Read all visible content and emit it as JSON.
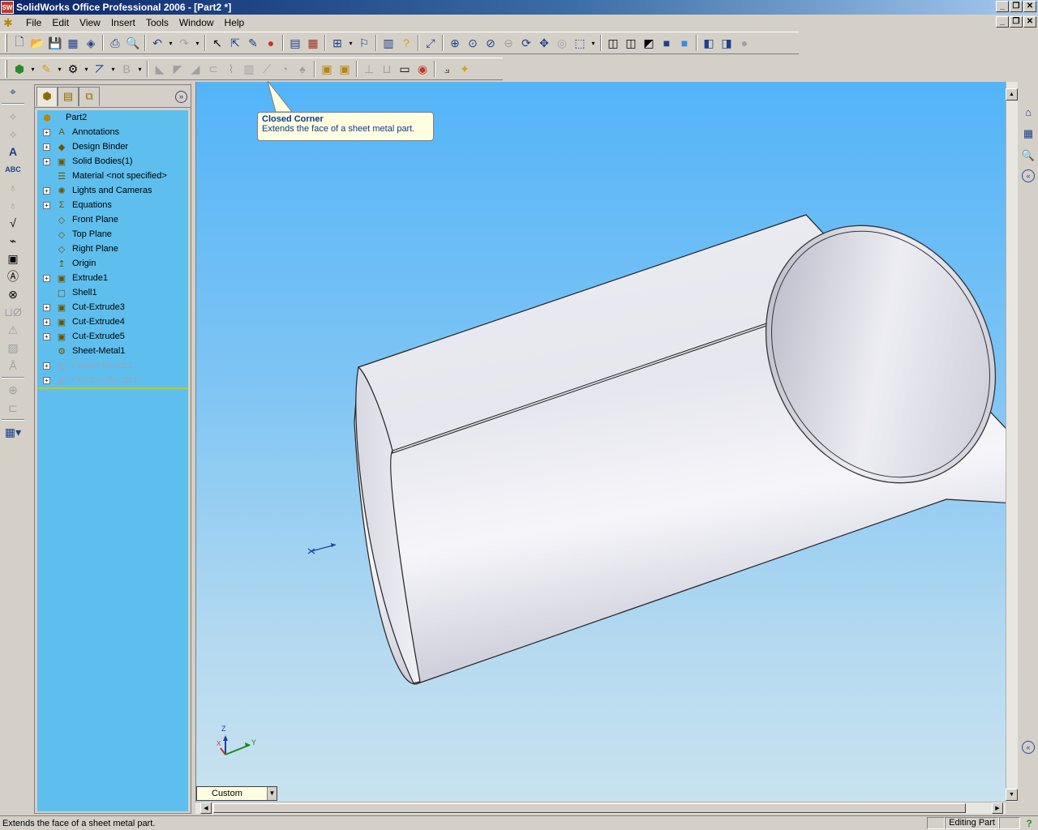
{
  "window": {
    "title": "SolidWorks Office Professional 2006 - [Part2 *]",
    "logo_text": "SW",
    "minimize": "_",
    "restore": "❐",
    "close": "✕"
  },
  "menu": {
    "items": [
      "File",
      "Edit",
      "View",
      "Insert",
      "Tools",
      "Window",
      "Help"
    ]
  },
  "feature_tree": {
    "root": "Part2",
    "items": [
      {
        "label": "Annotations",
        "icon": "annotations-icon",
        "glyph": "A",
        "expandable": true,
        "dim": false
      },
      {
        "label": "Design Binder",
        "icon": "design-binder-icon",
        "glyph": "◆",
        "expandable": true,
        "dim": false
      },
      {
        "label": "Solid Bodies(1)",
        "icon": "solid-bodies-icon",
        "glyph": "▣",
        "expandable": true,
        "dim": false
      },
      {
        "label": "Material <not specified>",
        "icon": "material-icon",
        "glyph": "☰",
        "expandable": false,
        "dim": false
      },
      {
        "label": "Lights and Cameras",
        "icon": "lights-cameras-icon",
        "glyph": "✺",
        "expandable": true,
        "dim": false
      },
      {
        "label": "Equations",
        "icon": "equations-icon",
        "glyph": "Σ",
        "expandable": true,
        "dim": false
      },
      {
        "label": "Front Plane",
        "icon": "plane-icon",
        "glyph": "◇",
        "expandable": false,
        "dim": false
      },
      {
        "label": "Top Plane",
        "icon": "plane-icon",
        "glyph": "◇",
        "expandable": false,
        "dim": false
      },
      {
        "label": "Right Plane",
        "icon": "plane-icon",
        "glyph": "◇",
        "expandable": false,
        "dim": false
      },
      {
        "label": "Origin",
        "icon": "origin-icon",
        "glyph": "↥",
        "expandable": false,
        "dim": false
      },
      {
        "label": "Extrude1",
        "icon": "extrude-icon",
        "glyph": "▣",
        "expandable": true,
        "dim": false
      },
      {
        "label": "Shell1",
        "icon": "shell-icon",
        "glyph": "▢",
        "expandable": false,
        "dim": false
      },
      {
        "label": "Cut-Extrude3",
        "icon": "cut-extrude-icon",
        "glyph": "▣",
        "expandable": true,
        "dim": false
      },
      {
        "label": "Cut-Extrude4",
        "icon": "cut-extrude-icon",
        "glyph": "▣",
        "expandable": true,
        "dim": false
      },
      {
        "label": "Cut-Extrude5",
        "icon": "cut-extrude-icon",
        "glyph": "▣",
        "expandable": true,
        "dim": false
      },
      {
        "label": "Sheet-Metal1",
        "icon": "sheet-metal-icon",
        "glyph": "⚙",
        "expandable": false,
        "dim": false
      },
      {
        "label": "Flatten-Bends1",
        "icon": "flatten-bends-icon",
        "glyph": "▤",
        "expandable": true,
        "dim": true
      },
      {
        "label": "Process-Bends1",
        "icon": "process-bends-icon",
        "glyph": "▤",
        "expandable": true,
        "dim": true
      }
    ]
  },
  "tooltip": {
    "title": "Closed Corner",
    "description": "Extends the face of a sheet metal part."
  },
  "triad": {
    "z": "Z",
    "y": "Y",
    "x": "X"
  },
  "configuration": {
    "value": "Custom"
  },
  "status": {
    "message": "Extends the face of a sheet metal part.",
    "mode": "Editing Part",
    "help": "?"
  },
  "colors": {
    "viewport_top": "#54b4f8",
    "viewport_bottom": "#c8e2ef",
    "tree_bg": "#5ebfee",
    "tooltip_bg": "#fffee1"
  }
}
